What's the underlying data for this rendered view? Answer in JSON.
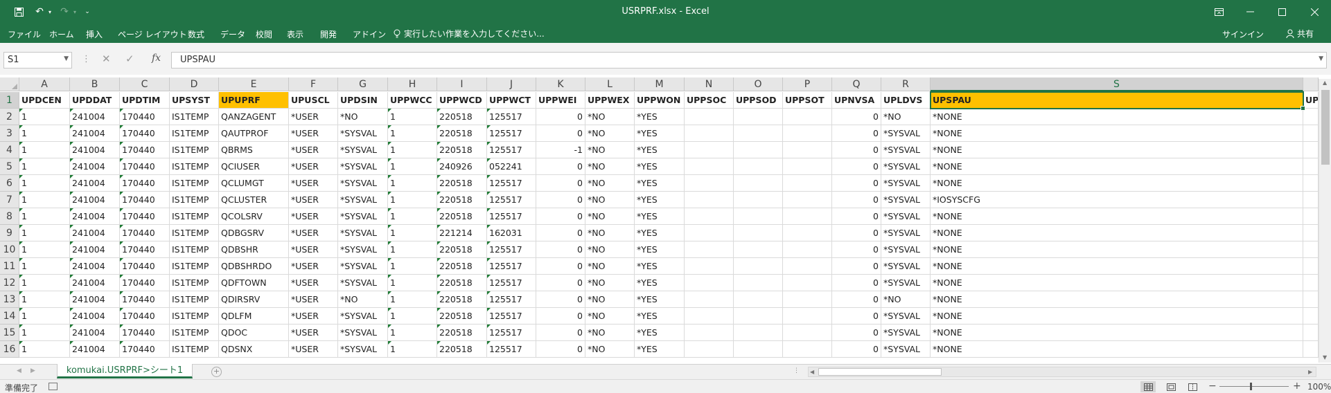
{
  "window": {
    "title": "USRPRF.xlsx - Excel"
  },
  "ribbon": {
    "tabs": [
      "ファイル",
      "ホーム",
      "挿入",
      "ページ レイアウト",
      "数式",
      "データ",
      "校閲",
      "表示",
      "開発",
      "アドイン"
    ],
    "tellme": "実行したい作業を入力してください...",
    "signin": "サインイン",
    "share": "共有"
  },
  "formula_bar": {
    "name_box": "S1",
    "formula": "UPSPAU"
  },
  "sheet": {
    "columns": [
      "A",
      "B",
      "C",
      "D",
      "E",
      "F",
      "G",
      "H",
      "I",
      "J",
      "K",
      "L",
      "M",
      "N",
      "O",
      "P",
      "Q",
      "R",
      "S"
    ],
    "selected_column": "S",
    "selected_cell": "S1",
    "highlight_color": "#ffc000",
    "highlighted_columns": [
      "E",
      "S"
    ],
    "header_row": [
      "UPDCEN",
      "UPDDAT",
      "UPDTIM",
      "UPSYST",
      "UPUPRF",
      "UPUSCL",
      "UPDSIN",
      "UPPWCC",
      "UPPWCD",
      "UPPWCT",
      "UPPWEI",
      "UPPWEX",
      "UPPWON",
      "UPPSOC",
      "UPPSOD",
      "UPPSOT",
      "UPNVSA",
      "UPLDVS",
      "UPSPAU"
    ],
    "next_header_partial": "UPI",
    "rows": [
      [
        "1",
        "241004",
        "170440",
        "IS1TEMP",
        "QANZAGENT",
        "*USER",
        "*NO",
        "1",
        "220518",
        "125517",
        "0",
        "*NO",
        "*YES",
        "",
        "",
        "",
        "0",
        "*NO",
        "*NONE"
      ],
      [
        "1",
        "241004",
        "170440",
        "IS1TEMP",
        "QAUTPROF",
        "*USER",
        "*SYSVAL",
        "1",
        "220518",
        "125517",
        "0",
        "*NO",
        "*YES",
        "",
        "",
        "",
        "0",
        "*SYSVAL",
        "*NONE"
      ],
      [
        "1",
        "241004",
        "170440",
        "IS1TEMP",
        "QBRMS",
        "*USER",
        "*SYSVAL",
        "1",
        "220518",
        "125517",
        "-1",
        "*NO",
        "*YES",
        "",
        "",
        "",
        "0",
        "*SYSVAL",
        "*NONE"
      ],
      [
        "1",
        "241004",
        "170440",
        "IS1TEMP",
        "QCIUSER",
        "*USER",
        "*SYSVAL",
        "1",
        "240926",
        "052241",
        "0",
        "*NO",
        "*YES",
        "",
        "",
        "",
        "0",
        "*SYSVAL",
        "*NONE"
      ],
      [
        "1",
        "241004",
        "170440",
        "IS1TEMP",
        "QCLUMGT",
        "*USER",
        "*SYSVAL",
        "1",
        "220518",
        "125517",
        "0",
        "*NO",
        "*YES",
        "",
        "",
        "",
        "0",
        "*SYSVAL",
        "*NONE"
      ],
      [
        "1",
        "241004",
        "170440",
        "IS1TEMP",
        "QCLUSTER",
        "*USER",
        "*SYSVAL",
        "1",
        "220518",
        "125517",
        "0",
        "*NO",
        "*YES",
        "",
        "",
        "",
        "0",
        "*SYSVAL",
        "*IOSYSCFG"
      ],
      [
        "1",
        "241004",
        "170440",
        "IS1TEMP",
        "QCOLSRV",
        "*USER",
        "*SYSVAL",
        "1",
        "220518",
        "125517",
        "0",
        "*NO",
        "*YES",
        "",
        "",
        "",
        "0",
        "*SYSVAL",
        "*NONE"
      ],
      [
        "1",
        "241004",
        "170440",
        "IS1TEMP",
        "QDBGSRV",
        "*USER",
        "*SYSVAL",
        "1",
        "221214",
        "162031",
        "0",
        "*NO",
        "*YES",
        "",
        "",
        "",
        "0",
        "*SYSVAL",
        "*NONE"
      ],
      [
        "1",
        "241004",
        "170440",
        "IS1TEMP",
        "QDBSHR",
        "*USER",
        "*SYSVAL",
        "1",
        "220518",
        "125517",
        "0",
        "*NO",
        "*YES",
        "",
        "",
        "",
        "0",
        "*SYSVAL",
        "*NONE"
      ],
      [
        "1",
        "241004",
        "170440",
        "IS1TEMP",
        "QDBSHRDO",
        "*USER",
        "*SYSVAL",
        "1",
        "220518",
        "125517",
        "0",
        "*NO",
        "*YES",
        "",
        "",
        "",
        "0",
        "*SYSVAL",
        "*NONE"
      ],
      [
        "1",
        "241004",
        "170440",
        "IS1TEMP",
        "QDFTOWN",
        "*USER",
        "*SYSVAL",
        "1",
        "220518",
        "125517",
        "0",
        "*NO",
        "*YES",
        "",
        "",
        "",
        "0",
        "*SYSVAL",
        "*NONE"
      ],
      [
        "1",
        "241004",
        "170440",
        "IS1TEMP",
        "QDIRSRV",
        "*USER",
        "*NO",
        "1",
        "220518",
        "125517",
        "0",
        "*NO",
        "*YES",
        "",
        "",
        "",
        "0",
        "*NO",
        "*NONE"
      ],
      [
        "1",
        "241004",
        "170440",
        "IS1TEMP",
        "QDLFM",
        "*USER",
        "*SYSVAL",
        "1",
        "220518",
        "125517",
        "0",
        "*NO",
        "*YES",
        "",
        "",
        "",
        "0",
        "*SYSVAL",
        "*NONE"
      ],
      [
        "1",
        "241004",
        "170440",
        "IS1TEMP",
        "QDOC",
        "*USER",
        "*SYSVAL",
        "1",
        "220518",
        "125517",
        "0",
        "*NO",
        "*YES",
        "",
        "",
        "",
        "0",
        "*SYSVAL",
        "*NONE"
      ],
      [
        "1",
        "241004",
        "170440",
        "IS1TEMP",
        "QDSNX",
        "*USER",
        "*SYSVAL",
        "1",
        "220518",
        "125517",
        "0",
        "*NO",
        "*YES",
        "",
        "",
        "",
        "0",
        "*SYSVAL",
        "*NONE"
      ]
    ]
  },
  "sheet_tabs": {
    "active": "komukai.USRPRF>シート1"
  },
  "status_bar": {
    "status": "準備完了",
    "zoom": "100%"
  }
}
